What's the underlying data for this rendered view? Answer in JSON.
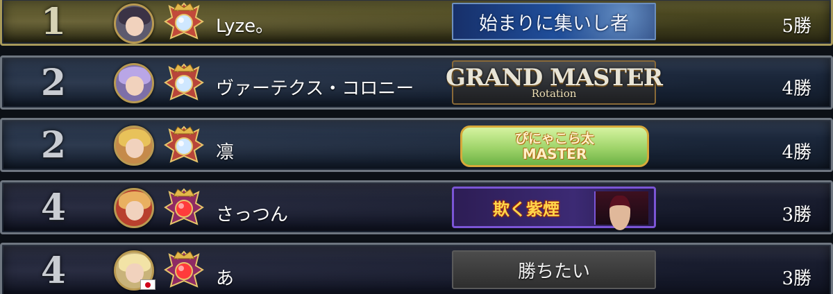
{
  "leaderboard": {
    "rows": [
      {
        "rank": "1",
        "name": "Lyze。",
        "title": "始まりに集いし者",
        "title_sub": "",
        "wins": "5勝",
        "avatar_hair": "#3b3346",
        "avatar_bg": "#5d5a6e",
        "emblem_gem": "#cfe7ff",
        "flag": false
      },
      {
        "rank": "2",
        "name": "ヴァーテクス・コロニー",
        "title": "GRAND MASTER",
        "title_sub": "Rotation",
        "wins": "4勝",
        "avatar_hair": "#b9a6e6",
        "avatar_bg": "#7d6fa8",
        "emblem_gem": "#cfe7ff",
        "flag": false
      },
      {
        "rank": "2",
        "name": "凛",
        "title": "ぴにゃこら太",
        "title_sub": "MASTER",
        "wins": "4勝",
        "avatar_hair": "#e8c25a",
        "avatar_bg": "#c58a4a",
        "emblem_gem": "#cfe7ff",
        "flag": false
      },
      {
        "rank": "4",
        "name": "さっつん",
        "title": "欺く紫煙",
        "title_sub": "",
        "wins": "3勝",
        "avatar_hair": "#e9b060",
        "avatar_bg": "#b8402e",
        "emblem_gem": "#ff3b3b",
        "flag": false
      },
      {
        "rank": "4",
        "name": "あ",
        "title": "勝ちたい",
        "title_sub": "",
        "wins": "3勝",
        "avatar_hair": "#f2e3a6",
        "avatar_bg": "#c9b37a",
        "emblem_gem": "#ff3b3b",
        "flag": true
      }
    ]
  },
  "colors": {
    "row_border": "#6e7680",
    "gold_row_bg": "#4a4620",
    "avatar_ring": "#b99a52",
    "text": "#ffffff"
  }
}
